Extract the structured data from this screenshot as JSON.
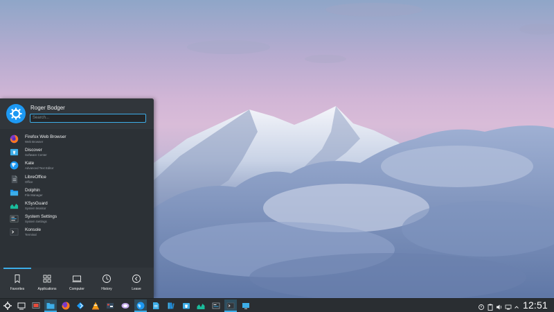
{
  "user": {
    "name": "Roger Bodger"
  },
  "search": {
    "placeholder": "Search..."
  },
  "favorites": [
    {
      "name": "Firefox Web Browser",
      "desc": "Web Browser",
      "icon": "firefox-icon"
    },
    {
      "name": "Discover",
      "desc": "Software Center",
      "icon": "discover-icon"
    },
    {
      "name": "Kate",
      "desc": "Advanced Text Editor",
      "icon": "kate-icon"
    },
    {
      "name": "LibreOffice",
      "desc": "Office",
      "icon": "libreoffice-icon"
    },
    {
      "name": "Dolphin",
      "desc": "File Manager",
      "icon": "dolphin-icon"
    },
    {
      "name": "KSysGuard",
      "desc": "System Monitor",
      "icon": "ksysguard-icon"
    },
    {
      "name": "System Settings",
      "desc": "System Settings",
      "icon": "settings-icon"
    },
    {
      "name": "Konsole",
      "desc": "Terminal",
      "icon": "konsole-icon"
    }
  ],
  "tabs": [
    {
      "label": "Favorites",
      "icon": "bookmark-icon",
      "active": true
    },
    {
      "label": "Applications",
      "icon": "grid-icon",
      "active": false
    },
    {
      "label": "Computer",
      "icon": "computer-icon",
      "active": false
    },
    {
      "label": "History",
      "icon": "clock-icon",
      "active": false
    },
    {
      "label": "Leave",
      "icon": "arrow-left-icon",
      "active": false
    }
  ],
  "clock": {
    "time": "12:51"
  },
  "colors": {
    "accent": "#3daee9",
    "panel": "#2a2e32",
    "menu": "#2c3136"
  }
}
